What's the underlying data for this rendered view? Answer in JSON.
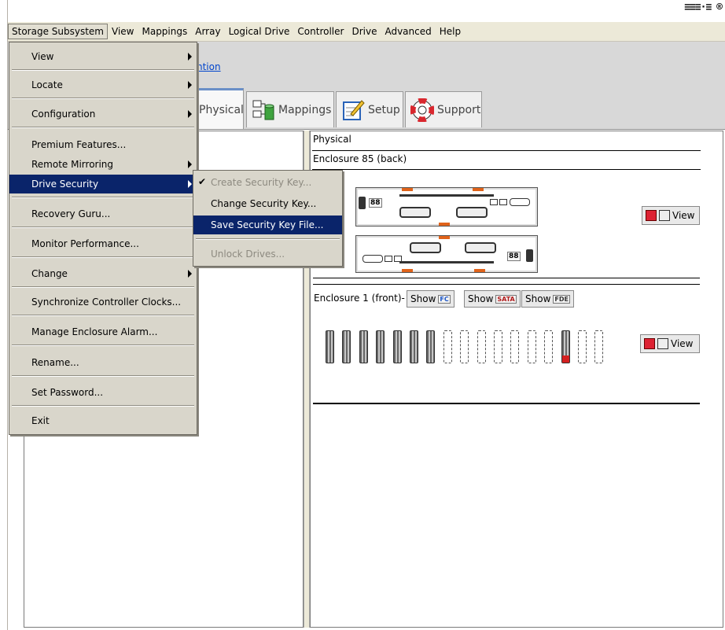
{
  "brand": {
    "logo_text": "≡≡≡·≡ ®"
  },
  "menubar": {
    "items": [
      {
        "label": "Storage Subsystem",
        "active": true
      },
      {
        "label": "View"
      },
      {
        "label": "Mappings"
      },
      {
        "label": "Array"
      },
      {
        "label": "Logical Drive"
      },
      {
        "label": "Controller"
      },
      {
        "label": "Drive"
      },
      {
        "label": "Advanced"
      },
      {
        "label": "Help"
      }
    ]
  },
  "toolbar": {
    "link_text": "ntion"
  },
  "tabs": [
    {
      "label": "Physical",
      "selected": true
    },
    {
      "label": "Mappings"
    },
    {
      "label": "Setup"
    },
    {
      "label": "Support"
    }
  ],
  "storage_menu": {
    "items": [
      {
        "label": "View",
        "submenu": true
      },
      {
        "label": "Locate",
        "submenu": true
      },
      {
        "label": "Configuration",
        "submenu": true
      },
      {
        "label": "Premium Features..."
      },
      {
        "label": "Remote Mirroring",
        "submenu": true
      },
      {
        "label": "Drive Security",
        "submenu": true,
        "highlighted": true
      },
      {
        "label": "Recovery Guru..."
      },
      {
        "label": "Monitor Performance..."
      },
      {
        "label": "Change",
        "submenu": true
      },
      {
        "label": "Synchronize Controller Clocks..."
      },
      {
        "label": "Manage Enclosure Alarm..."
      },
      {
        "label": "Rename..."
      },
      {
        "label": "Set Password..."
      },
      {
        "label": "Exit"
      }
    ]
  },
  "security_submenu": {
    "items": [
      {
        "label": "Create Security Key...",
        "disabled": true,
        "checked": true
      },
      {
        "label": "Change Security Key..."
      },
      {
        "label": "Save Security Key File...",
        "highlighted": true
      },
      {
        "label": "Unlock Drives...",
        "disabled": true
      }
    ]
  },
  "physical_pane": {
    "title": "Physical",
    "enclosure_back_label": "Enclosure 85 (back)",
    "enclosure_front_label": "Enclosure 1 (front)-",
    "view_label": "View",
    "show_label": "Show",
    "show_badges": [
      "FC",
      "SATA",
      "FDE"
    ],
    "controller_display_a": "88",
    "controller_display_b": "88",
    "drive_slots": [
      "filled",
      "filled",
      "filled",
      "filled",
      "filled",
      "filled",
      "filled",
      "empty",
      "empty",
      "empty",
      "empty",
      "empty",
      "empty",
      "empty",
      "filled",
      "empty",
      "empty"
    ]
  },
  "colors": {
    "menu_highlight": "#0a246a",
    "tab_accent": "#6a8fc7",
    "enclosure_accent": "#e0631a"
  }
}
